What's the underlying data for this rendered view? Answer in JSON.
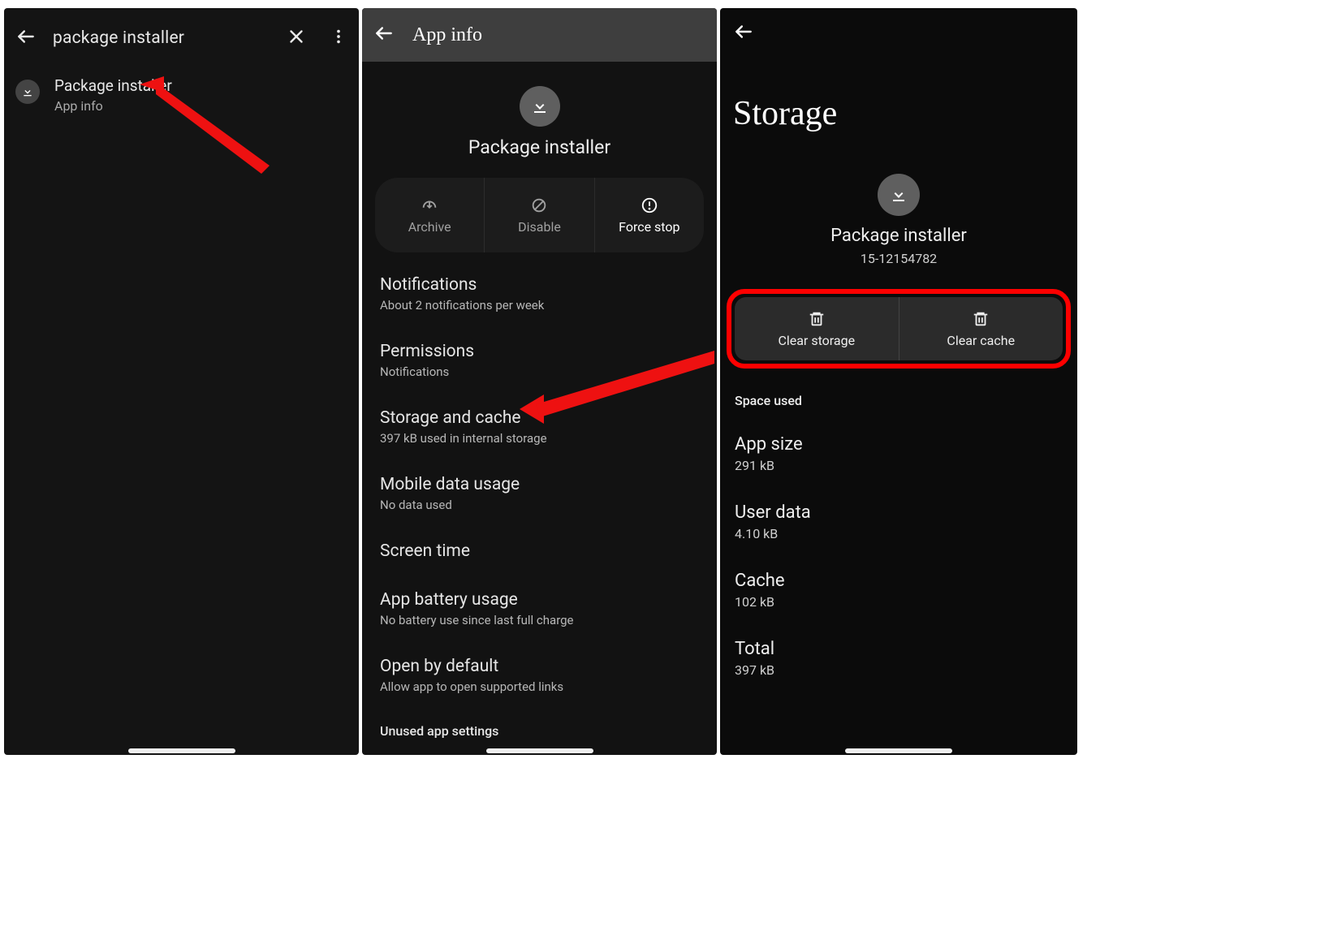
{
  "screen1": {
    "search_text": "package installer",
    "result": {
      "title": "Package installer",
      "subtitle": "App info"
    }
  },
  "screen2": {
    "header_title": "App info",
    "app_name": "Package installer",
    "actions": {
      "archive": "Archive",
      "disable": "Disable",
      "force_stop": "Force stop"
    },
    "items": [
      {
        "title": "Notifications",
        "sub": "About 2 notifications per week"
      },
      {
        "title": "Permissions",
        "sub": "Notifications"
      },
      {
        "title": "Storage and cache",
        "sub": "397 kB used in internal storage"
      },
      {
        "title": "Mobile data usage",
        "sub": "No data used"
      },
      {
        "title": "Screen time",
        "sub": ""
      },
      {
        "title": "App battery usage",
        "sub": "No battery use since last full charge"
      },
      {
        "title": "Open by default",
        "sub": "Allow app to open supported links"
      }
    ],
    "section": "Unused app settings"
  },
  "screen3": {
    "title": "Storage",
    "app_name": "Package installer",
    "version": "15-12154782",
    "clear_storage": "Clear storage",
    "clear_cache": "Clear cache",
    "space_used": "Space used",
    "stats": [
      {
        "title": "App size",
        "value": "291 kB"
      },
      {
        "title": "User data",
        "value": "4.10 kB"
      },
      {
        "title": "Cache",
        "value": "102 kB"
      },
      {
        "title": "Total",
        "value": "397 kB"
      }
    ]
  }
}
